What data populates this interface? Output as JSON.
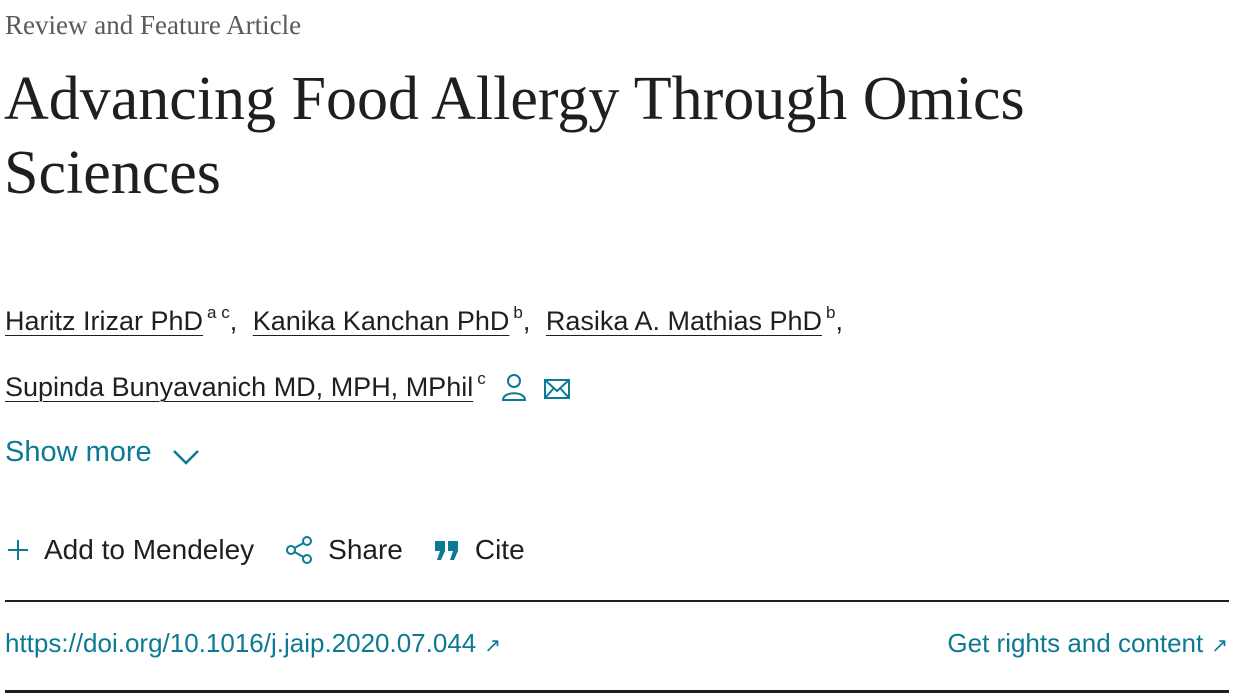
{
  "article": {
    "type_label": "Review and Feature Article",
    "title": "Advancing Food Allergy Through Omics Sciences"
  },
  "authors": [
    {
      "name": "Haritz Irizar PhD",
      "affiliations": "a c",
      "separator": ","
    },
    {
      "name": "Kanika Kanchan PhD",
      "affiliations": "b",
      "separator": ","
    },
    {
      "name": "Rasika A. Mathias PhD",
      "affiliations": "b",
      "separator": ","
    },
    {
      "name": "Supinda Bunyavanich MD, MPH, MPhil",
      "affiliations": "c",
      "separator": ""
    }
  ],
  "show_more": {
    "label": "Show more"
  },
  "toolbar": {
    "add_to_mendeley": "Add to Mendeley",
    "share": "Share",
    "cite": "Cite"
  },
  "links": {
    "doi": "https://doi.org/10.1016/j.jaip.2020.07.044",
    "rights": "Get rights and content",
    "external_glyph": "↗"
  },
  "icons": {
    "person": "person-icon",
    "email": "envelope-icon",
    "chevron": "chevron-down-icon",
    "plus": "plus-icon",
    "share": "share-icon",
    "cite": "quote-icon"
  },
  "colors": {
    "link": "#0c7a94",
    "text": "#1f1f1f",
    "muted": "#5a5a5a"
  }
}
